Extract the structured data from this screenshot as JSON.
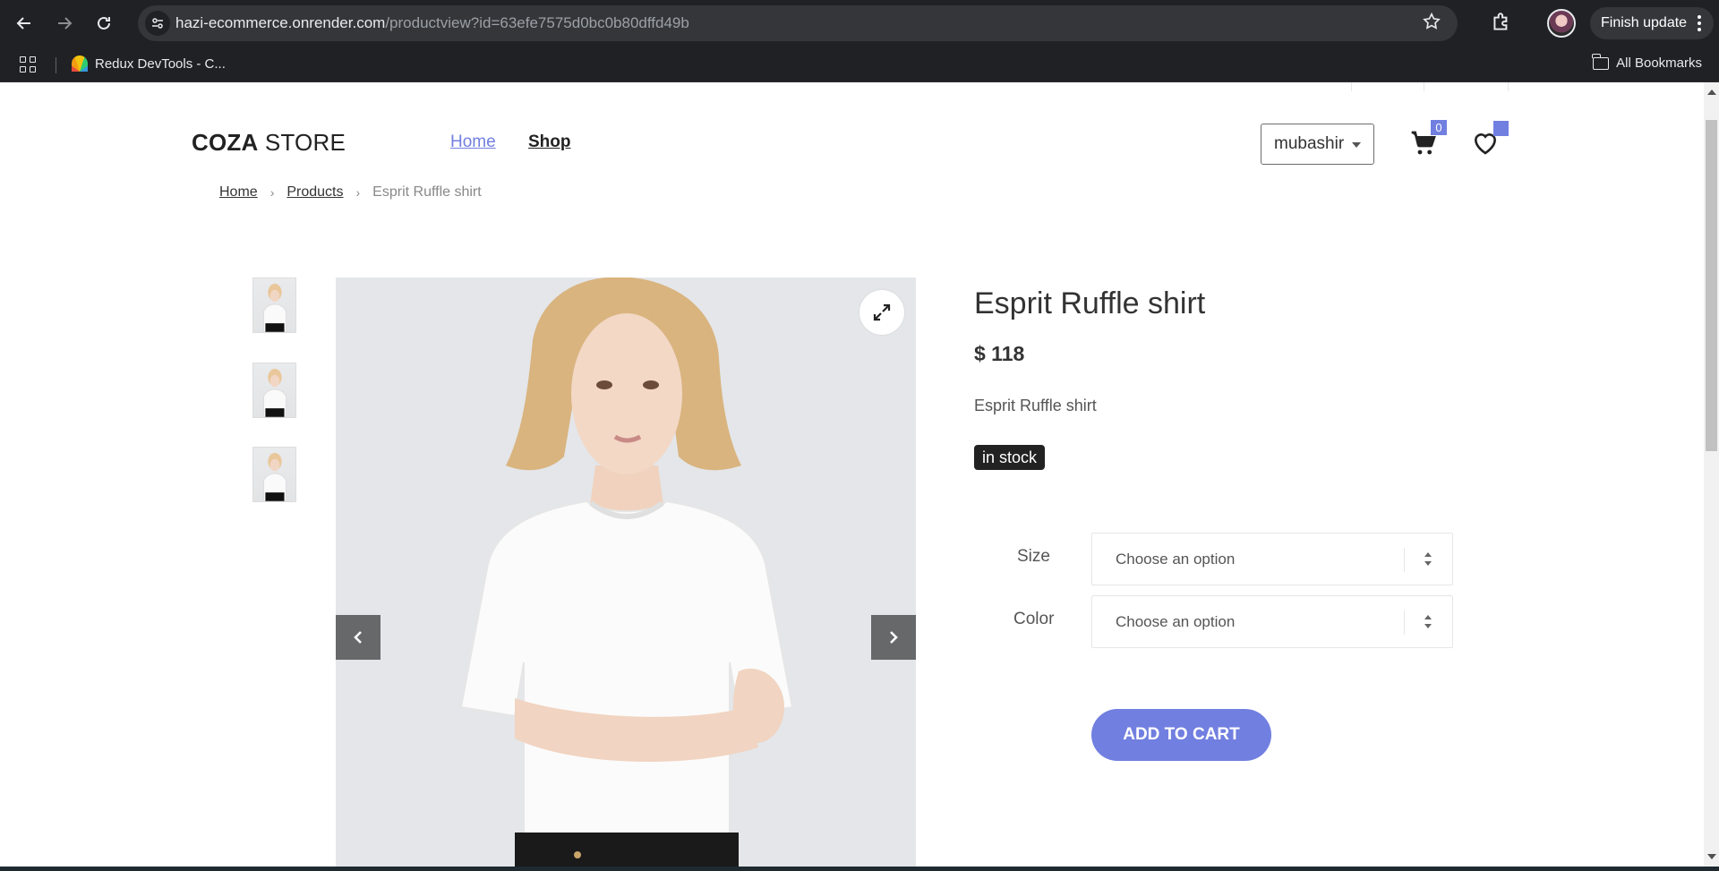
{
  "browser": {
    "url_host": "hazi-ecommerce.onrender.com",
    "url_path": "/productview?id=63efe7575d0bc0b80dffd49b",
    "finish_update_label": "Finish update",
    "bookmark_label": "Redux DevTools - C...",
    "all_bookmarks_label": "All Bookmarks"
  },
  "header": {
    "logo_bold": "COZA",
    "logo_light": " STORE",
    "nav": [
      {
        "label": "Home",
        "active": true
      },
      {
        "label": "Shop",
        "active": false
      }
    ],
    "user_label": "mubashir",
    "cart_count": "0"
  },
  "breadcrumb": {
    "items": [
      "Home",
      "Products"
    ],
    "current": "Esprit Ruffle shirt"
  },
  "product": {
    "title": "Esprit Ruffle shirt",
    "price": "$ 118",
    "description": "Esprit Ruffle shirt",
    "stock_label": "in stock",
    "size_label": "Size",
    "size_placeholder": "Choose an option",
    "color_label": "Color",
    "color_placeholder": "Choose an option",
    "add_to_cart_label": "ADD TO CART"
  },
  "colors": {
    "accent": "#717fe0",
    "browser_bg": "#202124",
    "text_dark": "#333333"
  }
}
